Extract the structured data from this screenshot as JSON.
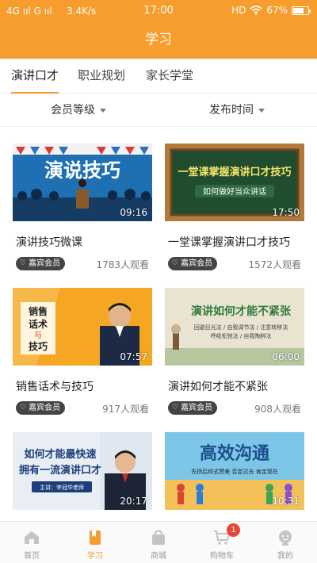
{
  "status_bar": {
    "signal": "4G ııl G ııl",
    "speed": "3.4K/s",
    "time": "17:00",
    "hd": "HD",
    "battery": "67%"
  },
  "header": {
    "title": "学习"
  },
  "tabs": [
    {
      "label": "演讲口才",
      "active": true
    },
    {
      "label": "职业规划",
      "active": false
    },
    {
      "label": "家长学堂",
      "active": false
    }
  ],
  "filters": [
    {
      "label": "会员等级"
    },
    {
      "label": "发布时间"
    }
  ],
  "courses": [
    {
      "title": "演讲技巧微课",
      "thumb_text": "演说技巧",
      "duration": "09:16",
      "badge": "嘉宾会员",
      "views": "1783人观看"
    },
    {
      "title": "一堂课掌握演讲口才技巧",
      "thumb_text": "一堂课掌握演讲口才技巧",
      "thumb_sub": "如何做好当众讲话",
      "duration": "17:50",
      "badge": "嘉宾会员",
      "views": "1572人观看"
    },
    {
      "title": "销售话术与技巧",
      "thumb_text": "销售话术与技巧",
      "duration": "07:57",
      "badge": "嘉宾会员",
      "views": "917人观看"
    },
    {
      "title": "演讲如何才能不紧张",
      "thumb_text": "演讲如何才能不紧张",
      "thumb_sub": "回避目光法 / 自我调节法 / 注意转移法 呼吸松弛法 / 自我陶醉法",
      "duration": "06:00",
      "badge": "嘉宾会员",
      "views": "908人观看"
    },
    {
      "title": "",
      "thumb_text": "如何才能最快速 拥有一流演讲口才",
      "thumb_sub": "主讲：李冠华老师",
      "duration": "20:17"
    },
    {
      "title": "",
      "thumb_text": "高效沟通",
      "thumb_sub": "先扬后抑式赞美 否定过去 肯定现在",
      "duration": "10:31"
    }
  ],
  "bottom_nav": [
    {
      "label": "首页",
      "icon": "home-icon",
      "active": false
    },
    {
      "label": "学习",
      "icon": "book-icon",
      "active": true
    },
    {
      "label": "商城",
      "icon": "shop-bag-icon",
      "active": false
    },
    {
      "label": "购物车",
      "icon": "cart-icon",
      "active": false,
      "badge": "1"
    },
    {
      "label": "我的",
      "icon": "profile-icon",
      "active": false
    }
  ],
  "colors": {
    "accent": "#f79d2e",
    "badge_bg": "#444444",
    "cart_badge": "#e8443a"
  }
}
